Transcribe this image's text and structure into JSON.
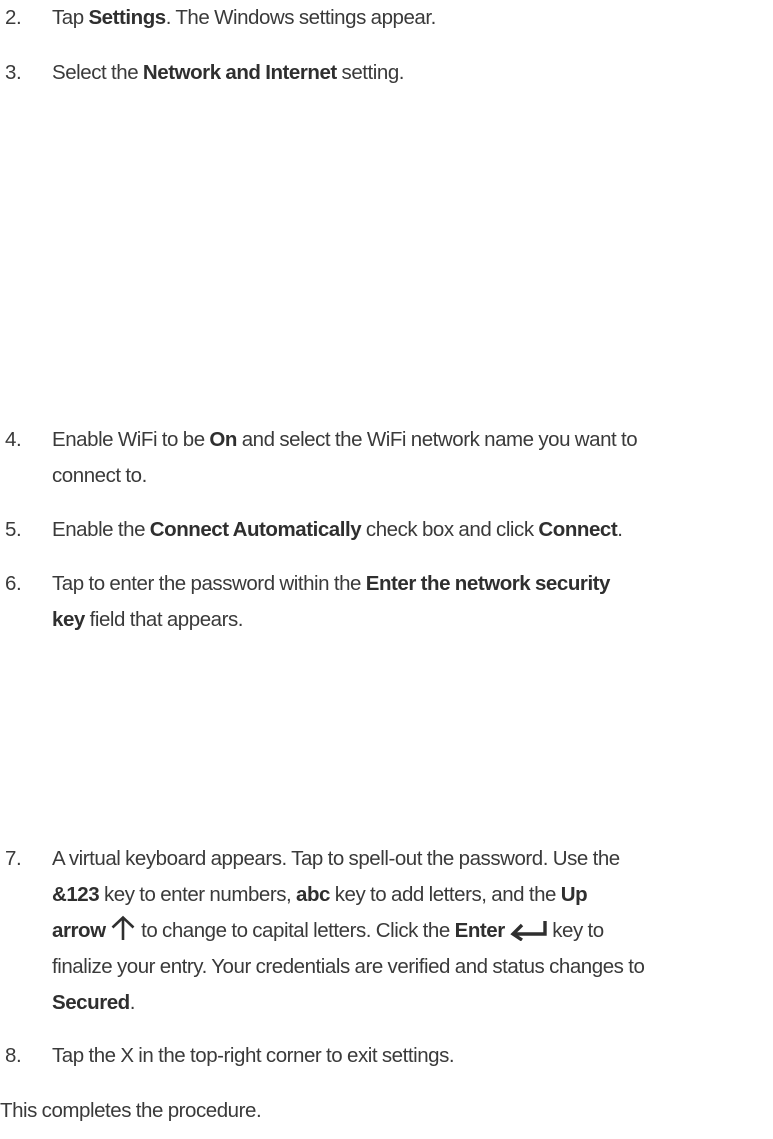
{
  "steps": [
    {
      "number": "2.",
      "parts": [
        "Tap ",
        "Settings",
        ". The Windows settings appear."
      ]
    },
    {
      "number": "3.",
      "parts": [
        "Select the ",
        "Network and Internet",
        " setting."
      ]
    },
    {
      "number": "4.",
      "line1": [
        "Enable WiFi to be ",
        "On",
        " and select the WiFi network name you want to"
      ],
      "line2": "connect to."
    },
    {
      "number": "5.",
      "parts": [
        "Enable the ",
        "Connect Automatically",
        " check box and click ",
        "Connect",
        "."
      ]
    },
    {
      "number": "6.",
      "line1": [
        "Tap to enter the password within the ",
        "Enter the network security"
      ],
      "line2": [
        "key",
        " field that appears."
      ]
    },
    {
      "number": "7.",
      "line1": "A virtual keyboard appears. Tap to spell-out the password. Use the",
      "line2": [
        "&123",
        " key to enter numbers, ",
        "abc",
        " key to add letters, and the ",
        "Up"
      ],
      "line3": [
        "arrow",
        " to change to capital letters. Click the ",
        "Enter",
        " key to"
      ],
      "line4": "finalize your entry. Your credentials are verified and status changes to",
      "line5": [
        "Secured",
        "."
      ]
    },
    {
      "number": "8.",
      "parts": [
        "Tap the X in the top-right corner to exit settings."
      ]
    }
  ],
  "closing": "This completes the procedure.",
  "icons": {
    "up_arrow": "up-arrow-icon",
    "enter": "enter-key-icon"
  }
}
